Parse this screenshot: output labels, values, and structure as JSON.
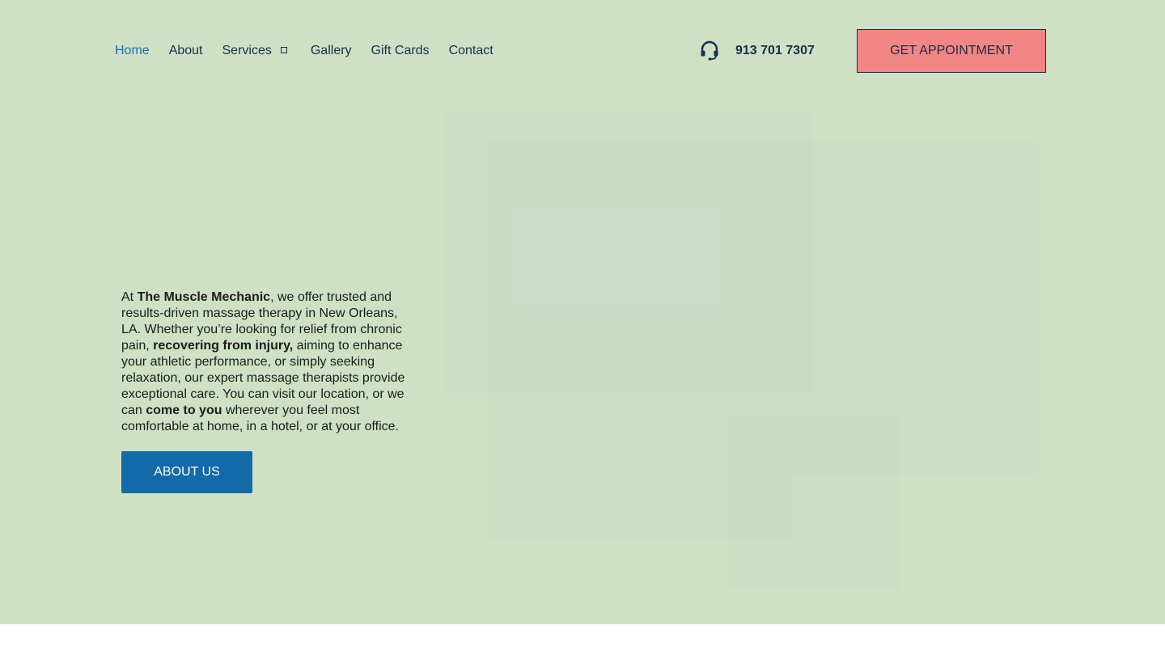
{
  "nav": {
    "items": [
      {
        "label": "Home"
      },
      {
        "label": "About"
      },
      {
        "label": "Services"
      },
      {
        "label": "Gallery"
      },
      {
        "label": "Gift Cards"
      },
      {
        "label": "Contact"
      }
    ],
    "active": "Home"
  },
  "contact": {
    "phone": "913 701 7307",
    "icon": "headset-icon"
  },
  "cta": {
    "label": "GET APPOINTMENT"
  },
  "intro": {
    "t1": "At ",
    "b1": "The Muscle Mechanic",
    "t2": ", we offer trusted and results-driven massage therapy in New Orleans, LA. Whether you’re looking for relief from chronic pain, ",
    "b2": "recovering from injury,",
    "t3": " aiming to enhance your athletic performance, or simply seeking relaxation, our expert massage therapists provide exceptional care. You can visit our location, or we can ",
    "b3": "come to you",
    "t4": " wherever you feel most comfortable at home, in a hotel, or at your office."
  },
  "about_button": {
    "label": "ABOUT US"
  },
  "colors": {
    "hero_background": "#cfe0c4",
    "nav_text": "#14324f",
    "nav_active": "#1d6fae",
    "cta_background": "#f28684",
    "about_button_background": "#126aa9"
  }
}
